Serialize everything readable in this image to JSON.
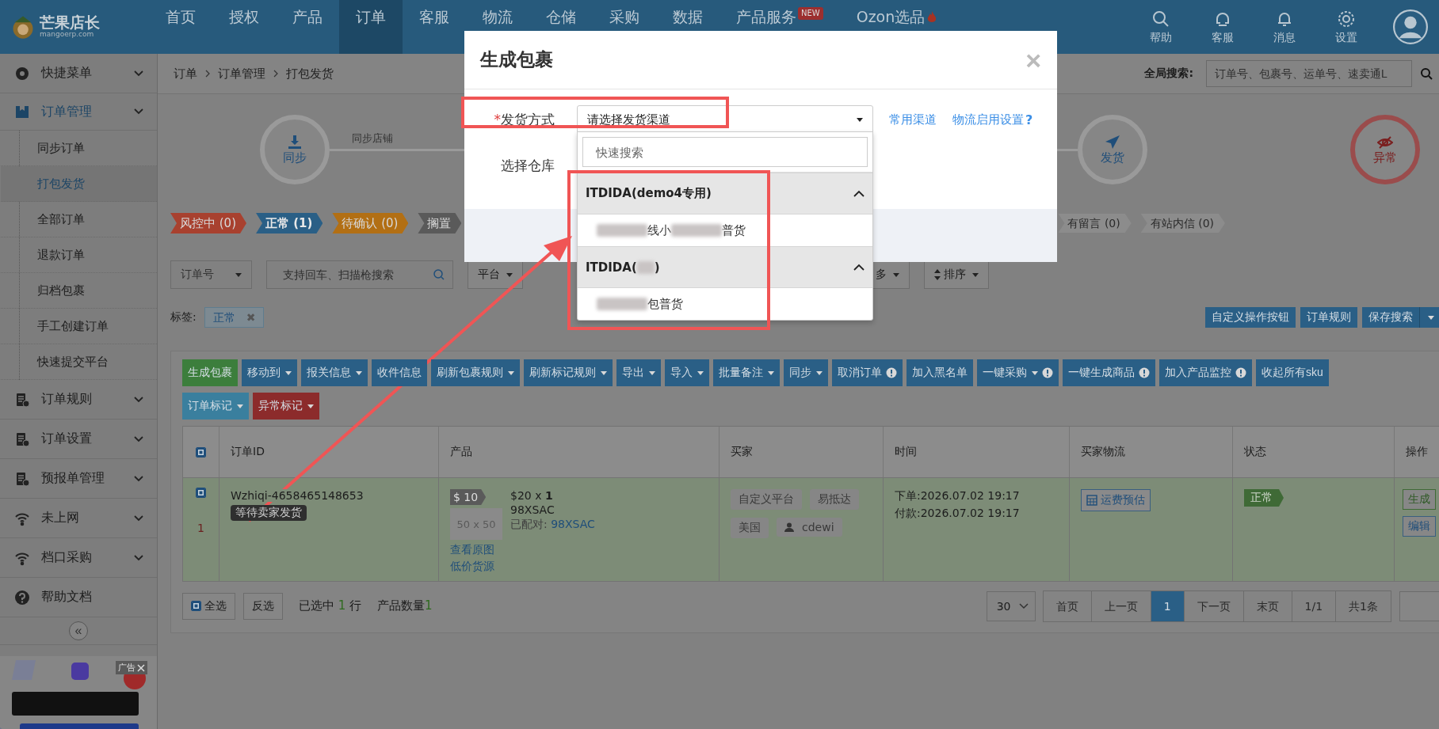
{
  "nav": {
    "logo_text": "芒果店长",
    "logo_sub": "mangoerp.com",
    "items": [
      {
        "label": "首页",
        "selected": false
      },
      {
        "label": "授权",
        "selected": false
      },
      {
        "label": "产品",
        "selected": false
      },
      {
        "label": "订单",
        "selected": true
      },
      {
        "label": "客服",
        "selected": false
      },
      {
        "label": "物流",
        "selected": false
      },
      {
        "label": "仓储",
        "selected": false
      },
      {
        "label": "采购",
        "selected": false
      },
      {
        "label": "数据",
        "selected": false
      },
      {
        "label": "产品服务",
        "selected": false,
        "badge": "NEW"
      },
      {
        "label": "Ozon选品",
        "selected": false,
        "hot": true
      }
    ],
    "actions": [
      {
        "label": "帮助",
        "kind": "search"
      },
      {
        "label": "客服",
        "kind": "service"
      },
      {
        "label": "消息",
        "kind": "bell"
      },
      {
        "label": "设置",
        "kind": "gear"
      }
    ]
  },
  "sidebar": {
    "items": [
      {
        "label": "快捷菜单",
        "chevron": true,
        "selected": false
      },
      {
        "label": "订单管理",
        "chevron": true,
        "selected": true,
        "children": [
          {
            "label": "同步订单",
            "selected": false
          },
          {
            "label": "打包发货",
            "selected": true
          },
          {
            "label": "全部订单",
            "selected": false
          },
          {
            "label": "退款订单",
            "selected": false
          },
          {
            "label": "归档包裹",
            "selected": false
          },
          {
            "label": "手工创建订单",
            "selected": false
          },
          {
            "label": "快速提交平台",
            "selected": false
          }
        ]
      },
      {
        "label": "订单规则",
        "chevron": true,
        "selected": false
      },
      {
        "label": "订单设置",
        "chevron": true,
        "selected": false
      },
      {
        "label": "预报单管理",
        "chevron": true,
        "selected": false
      },
      {
        "label": "未上网",
        "chevron": true,
        "selected": false
      },
      {
        "label": "档口采购",
        "chevron": true,
        "selected": false
      },
      {
        "label": "帮助文档",
        "chevron": false,
        "selected": false
      }
    ],
    "collapse": "«",
    "ad": {
      "label": "广告"
    }
  },
  "breadcrumb": [
    "订单",
    "订单管理",
    "打包发货"
  ],
  "global_search": {
    "label": "全局搜索:",
    "placeholder": "订单号、包裹号、运单号、速卖通L"
  },
  "steps": [
    {
      "label": "同步",
      "kind": "download",
      "link": "同步店铺"
    },
    {
      "label": "发货",
      "kind": "send"
    },
    {
      "label": "异常",
      "kind": "error"
    }
  ],
  "status_tabs": [
    {
      "label": "风控中 (0)",
      "color": "#a8412f",
      "selected": false
    },
    {
      "label": "正常 (1)",
      "color": "#2a5f86",
      "selected": true
    },
    {
      "label": "待确认 (0)",
      "color": "#b26f14",
      "selected": false
    },
    {
      "label": "搁置",
      "color": "#5a5a5a",
      "selected": false
    }
  ],
  "extra_tabs": [
    "有留言 (0)",
    "有站内信 (0)"
  ],
  "filters": {
    "field": "订单号",
    "search_placeholder": "支持回车、扫描枪搜索",
    "buttons": [
      "平台"
    ],
    "more": "多",
    "sort": "排序"
  },
  "tags": {
    "label": "标签:",
    "items": [
      "正常"
    ],
    "remove": "✖"
  },
  "tool_buttons": [
    "自定义操作按钮",
    "订单规则",
    "保存搜索"
  ],
  "actions": [
    {
      "label": "生成包裹",
      "kind": "success",
      "caret": false,
      "alert": false
    },
    {
      "label": "移动到",
      "kind": "primary",
      "caret": true,
      "alert": false
    },
    {
      "label": "报关信息",
      "kind": "primary",
      "caret": true,
      "alert": false
    },
    {
      "label": "收件信息",
      "kind": "primary",
      "caret": false,
      "alert": false
    },
    {
      "label": "刷新包裹规则",
      "kind": "primary",
      "caret": true,
      "alert": false
    },
    {
      "label": "刷新标记规则",
      "kind": "primary",
      "caret": true,
      "alert": false
    },
    {
      "label": "导出",
      "kind": "primary",
      "caret": true,
      "alert": false
    },
    {
      "label": "导入",
      "kind": "primary",
      "caret": true,
      "alert": false
    },
    {
      "label": "批量备注",
      "kind": "primary",
      "caret": true,
      "alert": false
    },
    {
      "label": "同步",
      "kind": "primary",
      "caret": true,
      "alert": false
    },
    {
      "label": "取消订单",
      "kind": "primary",
      "caret": false,
      "alert": true
    },
    {
      "label": "加入黑名单",
      "kind": "primary",
      "caret": false,
      "alert": false
    },
    {
      "label": "一键采购",
      "kind": "primary",
      "caret": true,
      "alert": true
    },
    {
      "label": "一键生成商品",
      "kind": "primary",
      "caret": false,
      "alert": true
    },
    {
      "label": "加入产品监控",
      "kind": "primary",
      "caret": false,
      "alert": true
    },
    {
      "label": "收起所有sku",
      "kind": "primary",
      "caret": false,
      "alert": false
    },
    {
      "label": "订单标记",
      "kind": "info",
      "caret": true,
      "alert": false
    },
    {
      "label": "异常标记",
      "kind": "danger",
      "caret": true,
      "alert": false
    }
  ],
  "table": {
    "header_checked": true,
    "columns": [
      "订单ID",
      "产品",
      "买家",
      "时间",
      "买家物流",
      "状态",
      "操作"
    ],
    "rows": [
      {
        "checked": true,
        "index": "1",
        "order_id": "Wzhiqi-4658465148653",
        "order_status": "等待卖家发货",
        "price": "$ 10",
        "thumb": "50 x 50",
        "qty_price": "$20 x **1**",
        "sku": "98XSAC",
        "matched_label": "已配对:",
        "matched": "98XSAC",
        "links": [
          "查看原图",
          "低价货源"
        ],
        "buyer_tags": [
          "自定义平台",
          "易抵达",
          "美国"
        ],
        "buyer_name": "cdewi",
        "times": [
          "下单:2026.07.02 19:17",
          "付款:2026.07.02 19:17"
        ],
        "logistics": "运费预估",
        "status": "正常",
        "ops": [
          "生成",
          "编辑"
        ]
      }
    ]
  },
  "footer": {
    "select_all": {
      "label": "全选",
      "checked": true
    },
    "invert": "反选",
    "selected_pre": "已选中",
    "selected_count": "1",
    "selected_post": "行",
    "product_label": "产品数量",
    "product_count": "1",
    "page_size": "30",
    "pages": [
      {
        "label": "首页",
        "selected": false
      },
      {
        "label": "上一页",
        "selected": false
      },
      {
        "label": "1",
        "selected": true
      },
      {
        "label": "下一页",
        "selected": false
      },
      {
        "label": "末页",
        "selected": false
      },
      {
        "label": "1/1",
        "selected": false
      },
      {
        "label": "共1条",
        "selected": false
      }
    ]
  },
  "modal": {
    "title": "生成包裹",
    "close": "×",
    "fields": [
      {
        "label": "发货方式",
        "required_mark": "*",
        "kind": "select",
        "placeholder": "请选择发货渠道",
        "links": [
          "常用渠道",
          "物流启用设置"
        ],
        "help": "?"
      },
      {
        "label": "选择仓库",
        "kind": "plain"
      }
    ],
    "dropdown": {
      "search_placeholder": "快速搜索",
      "groups": [
        {
          "segments": [
            {
              "kind": "text",
              "text": "ITDIDA(demo4专用)"
            }
          ],
          "options": [
            {
              "segments": [
                {
                  "kind": "blur"
                },
                {
                  "kind": "text",
                  "text": "线小"
                },
                {
                  "kind": "blur"
                },
                {
                  "kind": "text",
                  "text": "普货"
                }
              ]
            }
          ]
        },
        {
          "segments": [
            {
              "kind": "text",
              "text": "ITDIDA("
            },
            {
              "kind": "blur"
            },
            {
              "kind": "text",
              "text": ")"
            }
          ],
          "options": [
            {
              "segments": [
                {
                  "kind": "blur"
                },
                {
                  "kind": "text",
                  "text": "包普货"
                }
              ]
            }
          ]
        }
      ]
    }
  }
}
